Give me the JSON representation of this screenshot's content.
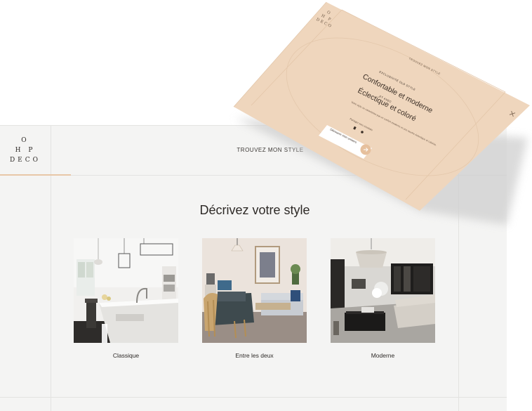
{
  "colors": {
    "screen_bg": "#f4f4f3",
    "accent": "#e8c7a7",
    "card_bg": "#efd6bd",
    "highlight": "#b9ddc7",
    "text": "#2e2a27"
  },
  "logo": {
    "line1": "O",
    "line2": "H P",
    "line3": "DECO"
  },
  "header": {
    "title": "TROUVEZ MON STYLE"
  },
  "main": {
    "heading_prefix": "Décrivez ",
    "heading_highlight": "votre style",
    "options": [
      {
        "label": "Classique",
        "image": "classic-kitchen-photo"
      },
      {
        "label": "Entre les deux",
        "image": "living-room-photo"
      },
      {
        "label": "Moderne",
        "image": "modern-living-room-photo"
      }
    ]
  },
  "overlay_card": {
    "logo_line1": "O",
    "logo_line2": "H P",
    "logo_line3": "DECO",
    "header_title": "TROUVEZ MON STYLE",
    "kicker": "EXCLUSIVITÉ OLD STYLE",
    "line1": "Confortable et moderne",
    "connector": "ET AVEC",
    "line2": "Éclectique et coloré",
    "body": "Votre style se caractérise par un confort moderne et une touche éclectique et colorée.",
    "share_label": "Partager mes résultats",
    "cta_label": "Découvrir mon univers",
    "close_icon": "close-icon"
  }
}
